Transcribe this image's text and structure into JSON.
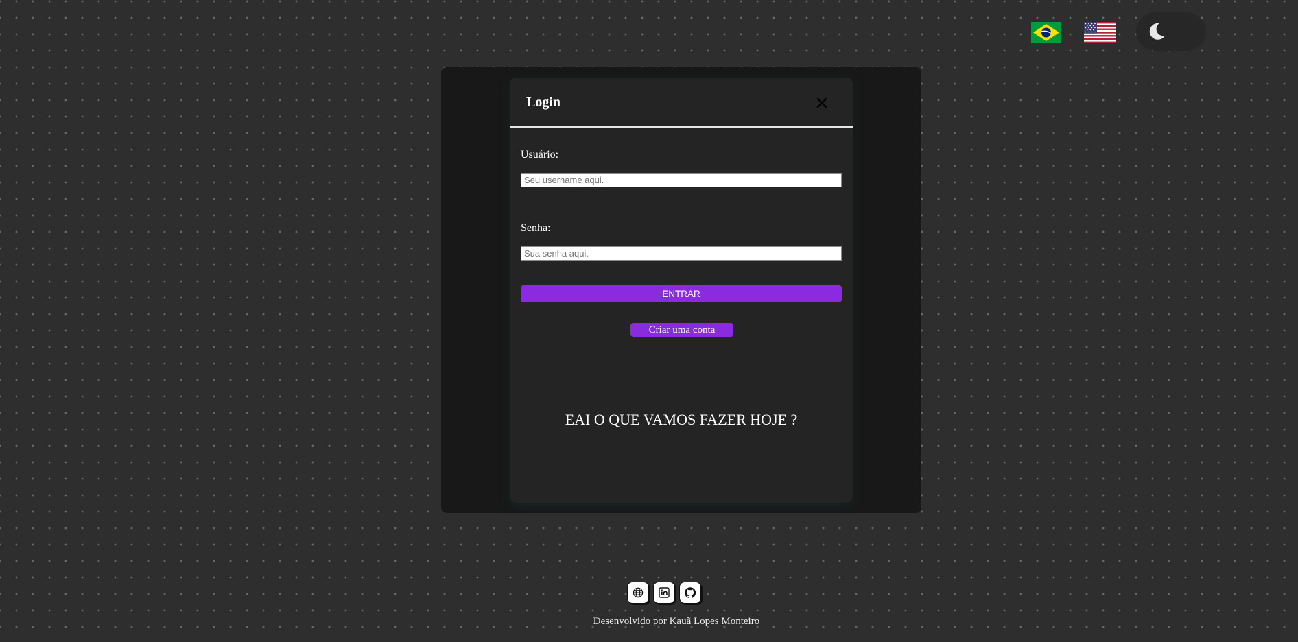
{
  "top_bar": {
    "languages": [
      {
        "icon": "brazil-flag-icon"
      },
      {
        "icon": "usa-flag-icon"
      }
    ],
    "theme_toggle": {
      "icon": "moon-icon"
    }
  },
  "login_modal": {
    "title": "Login",
    "close_icon": "close-icon",
    "username": {
      "label": "Usuário:",
      "placeholder": "Seu username aqui.",
      "value": ""
    },
    "password": {
      "label": "Senha:",
      "placeholder": "Sua senha aqui.",
      "value": ""
    },
    "submit_label": "ENTRAR",
    "create_account_label": "Criar uma conta",
    "tagline": "EAI O QUE VAMOS FAZER HOJE ?"
  },
  "footer": {
    "social_icons": [
      "globe-icon",
      "linkedin-icon",
      "github-icon"
    ],
    "credit": "Desenvolvido por Kauã Lopes Monteiro"
  },
  "colors": {
    "page_background": "#2e2e2e",
    "backdrop": "#181818",
    "modal_background": "#242424",
    "accent": "#8a2be2",
    "toggle_background": "#272727"
  }
}
